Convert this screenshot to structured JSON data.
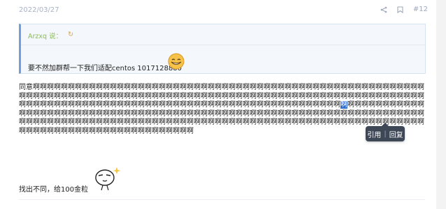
{
  "post": {
    "date": "2022/03/27",
    "number": "#12"
  },
  "quote": {
    "author": "Arzxq 说：",
    "arrow": "↻",
    "text": "要不然加群帮一下我们适配centos 1017128880"
  },
  "paragraph": {
    "prefix": "同意",
    "before_highlight": "啊啊啊啊啊啊啊啊啊啊啊啊啊啊啊啊啊啊啊啊啊啊啊啊啊啊啊啊啊啊啊啊啊啊啊啊啊啊啊啊啊啊啊啊啊啊啊啊啊啊啊啊啊啊啊啊啊啊啊啊啊啊啊啊啊啊啊啊啊啊啊啊啊啊啊啊啊啊啊啊啊啊啊啊啊啊啊啊啊啊啊啊啊啊啊啊啊啊啊啊啊啊啊啊啊啊啊啊啊啊啊啊啊啊啊啊啊啊啊啊啊啊啊啊啊啊啊啊啊啊啊啊啊啊啊啊啊啊啊啊啊啊啊啊啊啊啊啊啊啊啊啊啊啊啊啊啊啊啊啊",
    "highlight": "啊",
    "after_highlight": "啊啊啊啊啊啊啊啊啊啊啊啊啊啊啊啊啊啊啊啊啊啊啊啊啊啊啊啊啊啊啊啊啊啊啊啊啊啊啊啊啊啊啊啊啊啊啊啊啊啊啊啊啊啊啊啊啊啊啊啊啊啊啊啊啊啊啊啊啊啊啊啊啊啊啊啊啊啊啊啊啊啊啊啊啊啊啊啊啊啊啊啊啊啊啊啊啊啊啊啊啊啊啊啊啊啊啊啊啊啊啊啊啊啊啊啊啊啊啊啊啊啊啊啊啊啊啊啊啊啊啊啊啊啊啊啊啊啊啊啊啊啊啊啊啊啊啊啊啊啊啊啊"
  },
  "tooltip": {
    "quote_label": "引用",
    "separator": "|",
    "reply_label": "回复"
  },
  "closing": {
    "text": "找出不同，给100金粒"
  },
  "icons": {
    "share": "share-icon",
    "bookmark": "bookmark-icon",
    "emoji_smile": "smiley-emoji-icon",
    "emoji_meme": "meme-face-icon"
  },
  "colors": {
    "accent_blue": "#6e9fdb",
    "quote_author": "#8bbb57",
    "highlight": "#2f6fd1",
    "tooltip_bg": "#3e4756",
    "meta_gray": "#a9b1c7"
  }
}
